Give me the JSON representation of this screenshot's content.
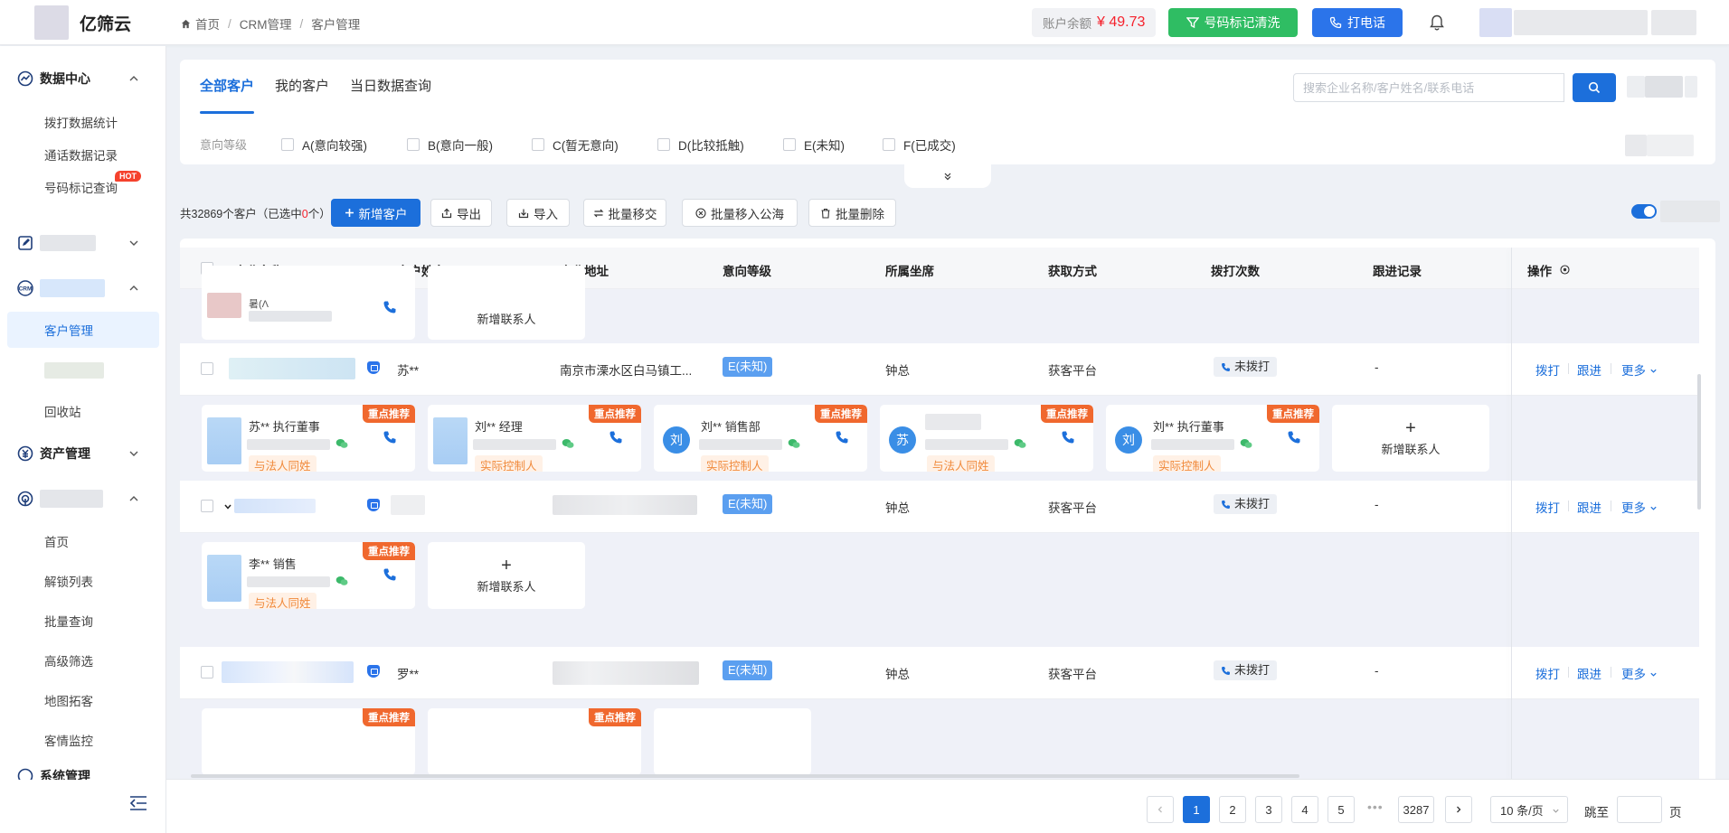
{
  "app": {
    "name": "亿筛云"
  },
  "breadcrumb": [
    "首页",
    "CRM管理",
    "客户管理"
  ],
  "header": {
    "balance_label": "账户余额",
    "balance_value": "¥ 49.73",
    "clean_button": "号码标记清洗",
    "call_button": "打电话"
  },
  "sidebar": {
    "groups": [
      {
        "label": "数据中心",
        "icon": "chart-icon",
        "items": [
          "拨打数据统计",
          "通话数据记录",
          "号码标记查询"
        ],
        "hot_badge": "HOT"
      },
      {
        "label": "",
        "icon": "edit-icon",
        "items": []
      },
      {
        "label": "",
        "icon": "crm-icon",
        "items": [
          "客户管理",
          "",
          "回收站"
        ],
        "active": "客户管理"
      },
      {
        "label": "资产管理",
        "icon": "asset-icon",
        "items": []
      },
      {
        "label": "",
        "icon": "target-icon",
        "items": [
          "首页",
          "解锁列表",
          "批量查询",
          "高级筛选",
          "地图拓客",
          "客情监控"
        ]
      },
      {
        "label": "系统管理",
        "icon": "settings-icon",
        "items": []
      }
    ]
  },
  "tabs": [
    "全部客户",
    "我的客户",
    "当日数据查询"
  ],
  "search": {
    "placeholder": "搜索企业名称/客户姓名/联系电话"
  },
  "filter": {
    "label": "意向等级",
    "options": [
      "A(意向较强)",
      "B(意向一般)",
      "C(暂无意向)",
      "D(比较抵触)",
      "E(未知)",
      "F(已成交)"
    ]
  },
  "toolbar": {
    "count_prefix": "共32869个客户（已选中",
    "count_selected": "0",
    "count_suffix": "个）",
    "add": "新增客户",
    "export": "导出",
    "import": "导入",
    "transfer": "批量移交",
    "move_pool": "批量移入公海",
    "delete": "批量删除"
  },
  "table": {
    "columns": [
      "企业名称",
      "客户姓名",
      "企业地址",
      "意向等级",
      "所属坐席",
      "获取方式",
      "拨打次数",
      "跟进记录",
      "操作"
    ],
    "rows": [
      {
        "contact": "苏**",
        "address": "南京市溧水区白马镇工...",
        "level": "E(未知)",
        "agent": "钟总",
        "source": "获客平台",
        "calls": "未拨打",
        "follow": "-"
      },
      {
        "contact": "",
        "address": "",
        "level": "E(未知)",
        "agent": "钟总",
        "source": "获客平台",
        "calls": "未拨打",
        "follow": "-"
      },
      {
        "contact": "罗**",
        "address": "",
        "level": "E(未知)",
        "agent": "钟总",
        "source": "获客平台",
        "calls": "未拨打",
        "follow": "-"
      }
    ],
    "actions": [
      "拨打",
      "跟进",
      "更多"
    ],
    "ribbon": "重点推荐",
    "add_contact": "新增联系人",
    "partial_card_name": "暑(Λ",
    "sub1_cards": [
      {
        "name": "苏** 执行董事",
        "tag": "与法人同姓",
        "avatar": ""
      },
      {
        "name": "刘** 经理",
        "tag": "实际控制人",
        "avatar": ""
      },
      {
        "name": "刘** 销售部",
        "tag": "实际控制人",
        "avatar": "刘"
      },
      {
        "name": "",
        "tag": "与法人同姓",
        "avatar": "苏"
      },
      {
        "name": "刘** 执行董事",
        "tag": "实际控制人",
        "avatar": "刘"
      }
    ],
    "sub2_cards": [
      {
        "name": "李** 销售",
        "tag": "与法人同姓",
        "avatar": ""
      }
    ]
  },
  "pagination": {
    "pages": [
      "1",
      "2",
      "3",
      "4",
      "5"
    ],
    "ellipsis": "•••",
    "last": "3287",
    "per_page": "10 条/页",
    "jump_label": "跳至",
    "page_label": "页"
  },
  "colors": {
    "primary": "#1c6fdb",
    "green": "#2fbd63",
    "ribbon": "#f0682e",
    "danger": "#f5222d"
  }
}
